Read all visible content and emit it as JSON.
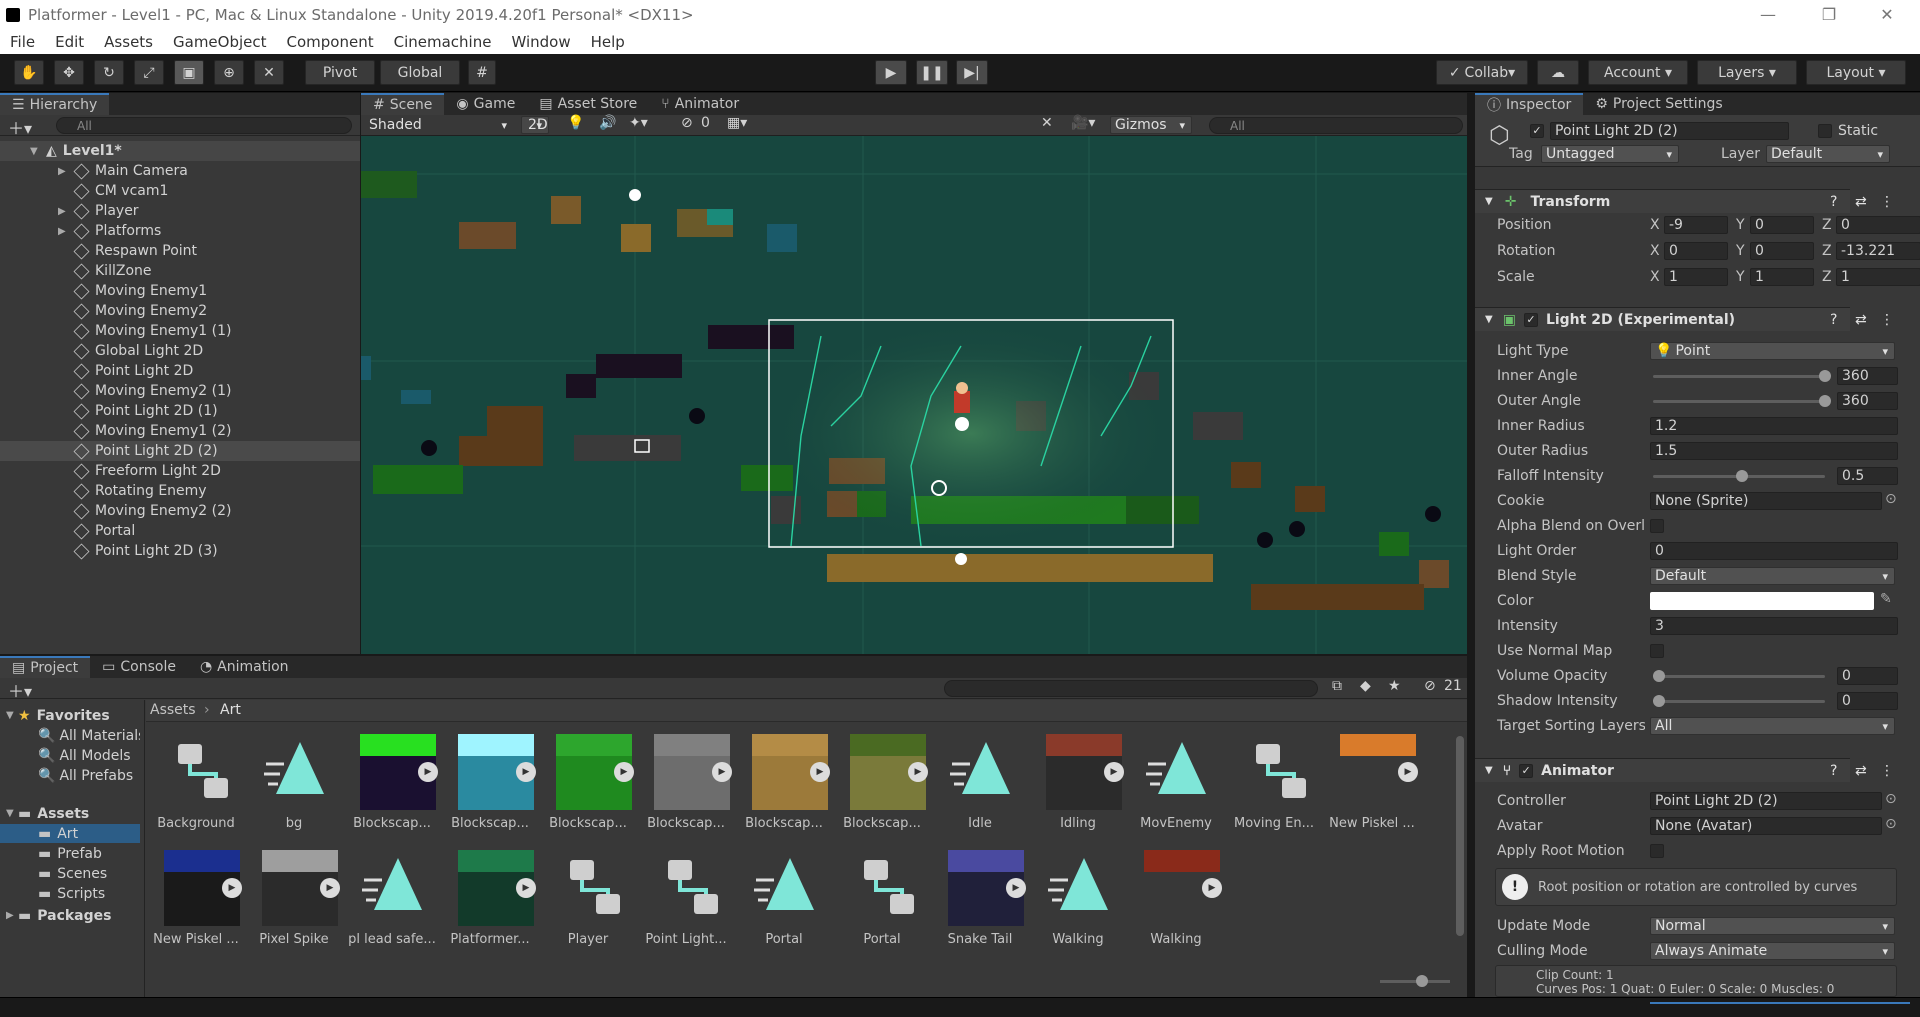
{
  "window": {
    "title": "Platformer - Level1 - PC, Mac & Linux Standalone - Unity 2019.4.20f1 Personal* <DX11>"
  },
  "menu": [
    "File",
    "Edit",
    "Assets",
    "GameObject",
    "Component",
    "Cinemachine",
    "Window",
    "Help"
  ],
  "toolbar": {
    "pivot": "Pivot",
    "global": "Global",
    "collab": "Collab",
    "account": "Account",
    "layers": "Layers",
    "layout": "Layout"
  },
  "hierarchy": {
    "tab": "Hierarchy",
    "search_placeholder": "All",
    "scene": "Level1*",
    "items": [
      {
        "label": "Main Camera",
        "arrow": true
      },
      {
        "label": "CM vcam1",
        "arrow": false
      },
      {
        "label": "Player",
        "arrow": true
      },
      {
        "label": "Platforms",
        "arrow": true
      },
      {
        "label": "Respawn Point",
        "arrow": false
      },
      {
        "label": "KillZone",
        "arrow": false
      },
      {
        "label": "Moving Enemy1",
        "arrow": false
      },
      {
        "label": "Moving Enemy2",
        "arrow": false
      },
      {
        "label": "Moving Enemy1 (1)",
        "arrow": false
      },
      {
        "label": "Global Light 2D",
        "arrow": false
      },
      {
        "label": "Point Light 2D",
        "arrow": false
      },
      {
        "label": "Moving Enemy2 (1)",
        "arrow": false
      },
      {
        "label": "Point Light 2D (1)",
        "arrow": false
      },
      {
        "label": "Moving Enemy1 (2)",
        "arrow": false
      },
      {
        "label": "Point Light 2D (2)",
        "arrow": false,
        "selected": true
      },
      {
        "label": "Freeform Light 2D",
        "arrow": false
      },
      {
        "label": "Rotating Enemy",
        "arrow": false
      },
      {
        "label": "Moving Enemy2 (2)",
        "arrow": false
      },
      {
        "label": "Portal",
        "arrow": false
      },
      {
        "label": "Point Light 2D (3)",
        "arrow": false
      }
    ]
  },
  "scene": {
    "tabs": [
      "Scene",
      "Game",
      "Asset Store",
      "Animator"
    ],
    "shading": "Shaded",
    "mode2d": "2D",
    "hidden_count": "0",
    "gizmos": "Gizmos",
    "search_placeholder": "All"
  },
  "inspector": {
    "tabs": [
      "Inspector",
      "Project Settings"
    ],
    "object_name": "Point Light 2D (2)",
    "static": "Static",
    "tag_label": "Tag",
    "tag": "Untagged",
    "layer_label": "Layer",
    "layer": "Default",
    "transform": {
      "title": "Transform",
      "rows": [
        {
          "label": "Position",
          "x": "-9",
          "y": "0",
          "z": "0"
        },
        {
          "label": "Rotation",
          "x": "0",
          "y": "0",
          "z": "-13.221"
        },
        {
          "label": "Scale",
          "x": "1",
          "y": "1",
          "z": "1"
        }
      ]
    },
    "axes": {
      "x": "X",
      "y": "Y",
      "z": "Z"
    },
    "light": {
      "title": "Light 2D (Experimental)",
      "light_type_label": "Light Type",
      "light_type": "Point",
      "inner_angle_label": "Inner Angle",
      "inner_angle": "360",
      "outer_angle_label": "Outer Angle",
      "outer_angle": "360",
      "inner_radius_label": "Inner Radius",
      "inner_radius": "1.2",
      "outer_radius_label": "Outer Radius",
      "outer_radius": "1.5",
      "falloff_label": "Falloff Intensity",
      "falloff": "0.5",
      "cookie_label": "Cookie",
      "cookie": "None (Sprite)",
      "alpha_blend_label": "Alpha Blend on Overl",
      "order_label": "Light Order",
      "order": "0",
      "blend_label": "Blend Style",
      "blend": "Default",
      "color_label": "Color",
      "color_value": "#ffffff",
      "intensity_label": "Intensity",
      "intensity": "3",
      "normal_map_label": "Use Normal Map",
      "volume_label": "Volume Opacity",
      "volume": "0",
      "shadow_label": "Shadow Intensity",
      "shadow": "0",
      "sorting_label": "Target Sorting Layers",
      "sorting": "All"
    },
    "animator": {
      "title": "Animator",
      "controller_label": "Controller",
      "controller": "Point Light 2D (2)",
      "avatar_label": "Avatar",
      "avatar": "None (Avatar)",
      "root_motion_label": "Apply Root Motion",
      "info": "Root position or rotation are controlled by curves",
      "update_label": "Update Mode",
      "update": "Normal",
      "culling_label": "Culling Mode",
      "culling": "Always Animate",
      "clip_count": "Clip Count: 1",
      "curves": "Curves Pos: 1 Quat: 0 Euler: 0 Scale: 0 Muscles: 0"
    }
  },
  "project": {
    "tabs": [
      "Project",
      "Console",
      "Animation"
    ],
    "hidden_count": "21",
    "favorites_label": "Favorites",
    "favorites": [
      "All Materials",
      "All Models",
      "All Prefabs"
    ],
    "assets_label": "Assets",
    "folders": [
      "Art",
      "Prefab",
      "Scenes",
      "Scripts"
    ],
    "packages_label": "Packages",
    "breadcrumb": [
      "Assets",
      "Art"
    ],
    "assets": [
      {
        "name": "Background",
        "kind": "ctrl"
      },
      {
        "name": "bg",
        "kind": "anim"
      },
      {
        "name": "Blockscap...",
        "kind": "sprite",
        "color": "#1a1030",
        "top": "#28e020",
        "play": true
      },
      {
        "name": "Blockscap...",
        "kind": "sprite",
        "color": "#2a8aa0",
        "top": "#9ff4ff",
        "play": true
      },
      {
        "name": "Blockscap...",
        "kind": "sprite",
        "color": "#1f8a1f",
        "top": "#2da62d",
        "play": true
      },
      {
        "name": "Blockscap...",
        "kind": "sprite",
        "color": "#6d6d6d",
        "top": "#808080",
        "play": true
      },
      {
        "name": "Blockscap...",
        "kind": "sprite",
        "color": "#9c7a3a",
        "top": "#b48c46",
        "play": true
      },
      {
        "name": "Blockscap...",
        "kind": "sprite",
        "color": "#7a7a3a",
        "top": "#4a6a22",
        "play": true
      },
      {
        "name": "Idle",
        "kind": "anim"
      },
      {
        "name": "Idling",
        "kind": "sprite",
        "color": "#2b2b2b",
        "top": "#8a3a2a",
        "play": true
      },
      {
        "name": "MovEnemy",
        "kind": "anim"
      },
      {
        "name": "Moving En...",
        "kind": "ctrl"
      },
      {
        "name": "New Piskel ...",
        "kind": "sprite",
        "color": "#383838",
        "top": "#d97b2b",
        "play": true
      },
      {
        "name": "New Piskel ...",
        "kind": "sprite",
        "color": "#1a1a1a",
        "top": "#1b2f8f",
        "play": true
      },
      {
        "name": "Pixel Spike",
        "kind": "sprite",
        "color": "#2b2b2b",
        "top": "#9e9e9e",
        "play": true
      },
      {
        "name": "pl lead safe...",
        "kind": "anim"
      },
      {
        "name": "Platformer...",
        "kind": "sprite",
        "color": "#123a2a",
        "top": "#1e7a4a",
        "play": true
      },
      {
        "name": "Player",
        "kind": "ctrl"
      },
      {
        "name": "Point Light...",
        "kind": "ctrl"
      },
      {
        "name": "Portal",
        "kind": "anim"
      },
      {
        "name": "Portal",
        "kind": "ctrl"
      },
      {
        "name": "Snake Tail",
        "kind": "sprite",
        "color": "#20203a",
        "top": "#4a4aa0",
        "play": true
      },
      {
        "name": "Walking",
        "kind": "anim"
      },
      {
        "name": "Walking",
        "kind": "sprite",
        "color": "#383838",
        "top": "#8a2a1a",
        "play": true
      }
    ]
  },
  "colors": {
    "accent": "#3a79bb",
    "anim_icon": "#7fe6d8",
    "scene_bg": "#17473f"
  }
}
